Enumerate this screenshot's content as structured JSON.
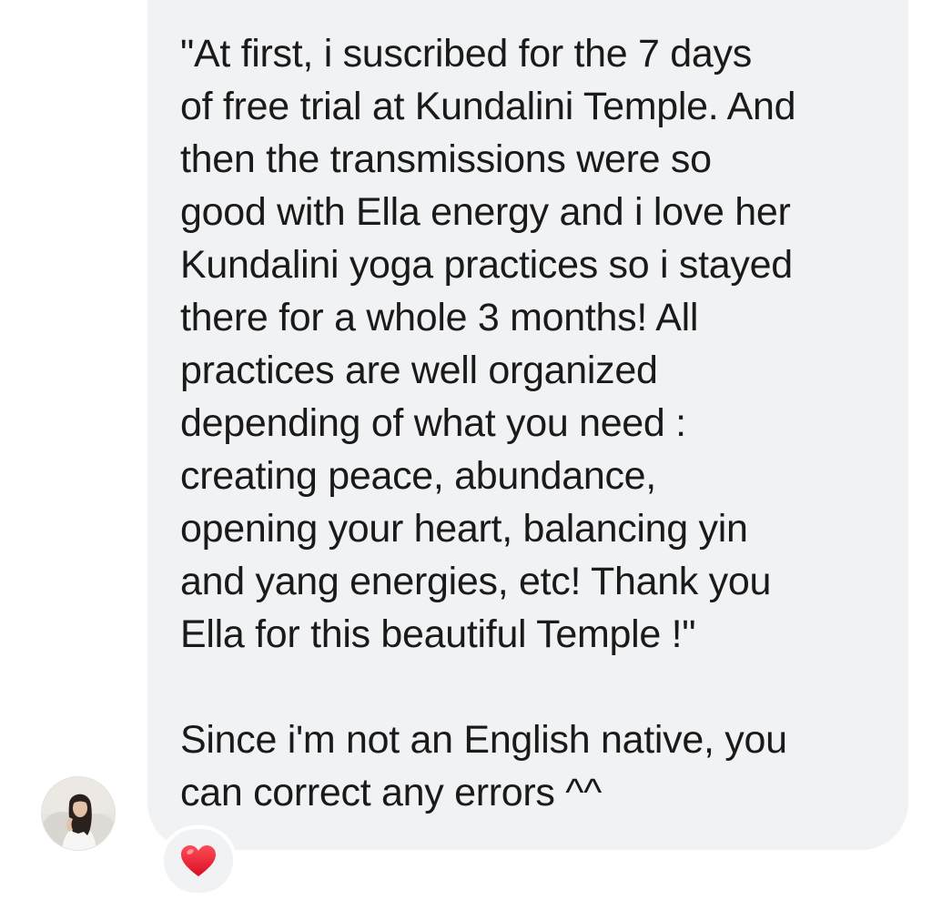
{
  "message": {
    "text": "\"At first, i suscribed for the 7 days\nof free trial at Kundalini Temple. And\nthen the transmissions were so\ngood with Ella energy and i love her\nKundalini yoga practices so i stayed\nthere for a whole 3 months! All\npractices are well organized\ndepending of what you need :\ncreating peace, abundance,\nopening your heart, balancing yin\nand yang energies, etc! Thank you\nElla for this beautiful Temple !\"\n\nSince i'm not an English native, you\ncan correct any errors ^^",
    "bubble_color": "#f1f2f4",
    "text_color": "#1a1a1a"
  },
  "sender": {
    "avatar_icon": "profile-photo"
  },
  "reaction": {
    "icon": "red-heart-icon",
    "color": "#e8192c"
  }
}
